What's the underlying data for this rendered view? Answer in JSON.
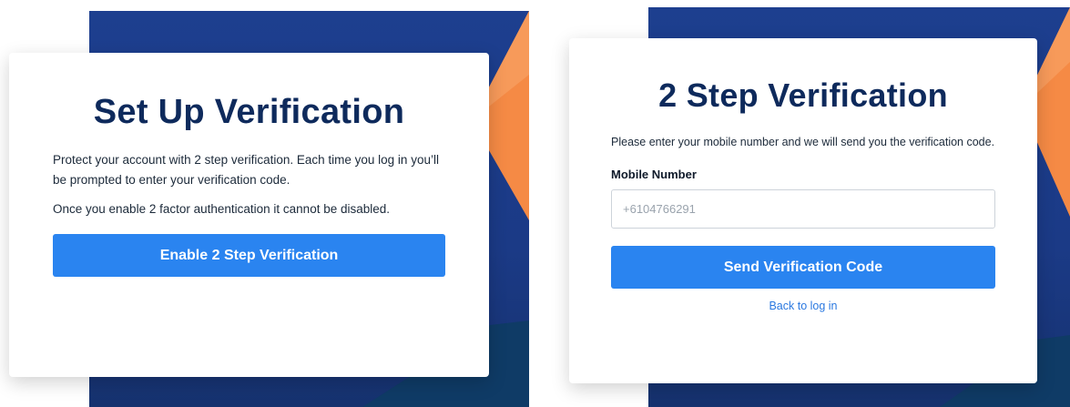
{
  "colors": {
    "brand_navy": "#0e2a5c",
    "button_blue": "#2a84f0",
    "link_blue": "#2a78e0",
    "background_blue": "#1d3f8f",
    "accent_orange": "#f58a45"
  },
  "setup_screen": {
    "title": "Set Up Verification",
    "description": "Protect your account with 2 step verification. Each time you log in you’ll be prompted to enter your verification code.",
    "notice": "Once you enable 2 factor authentication it cannot be disabled.",
    "enable_button_label": "Enable 2 Step Verification"
  },
  "verify_screen": {
    "title": "2 Step Verification",
    "description": "Please enter your mobile number and we will send you the verification code.",
    "mobile_label": "Mobile Number",
    "mobile_placeholder": "+6104766291",
    "send_button_label": "Send Verification Code",
    "back_link_label": "Back to log in"
  }
}
